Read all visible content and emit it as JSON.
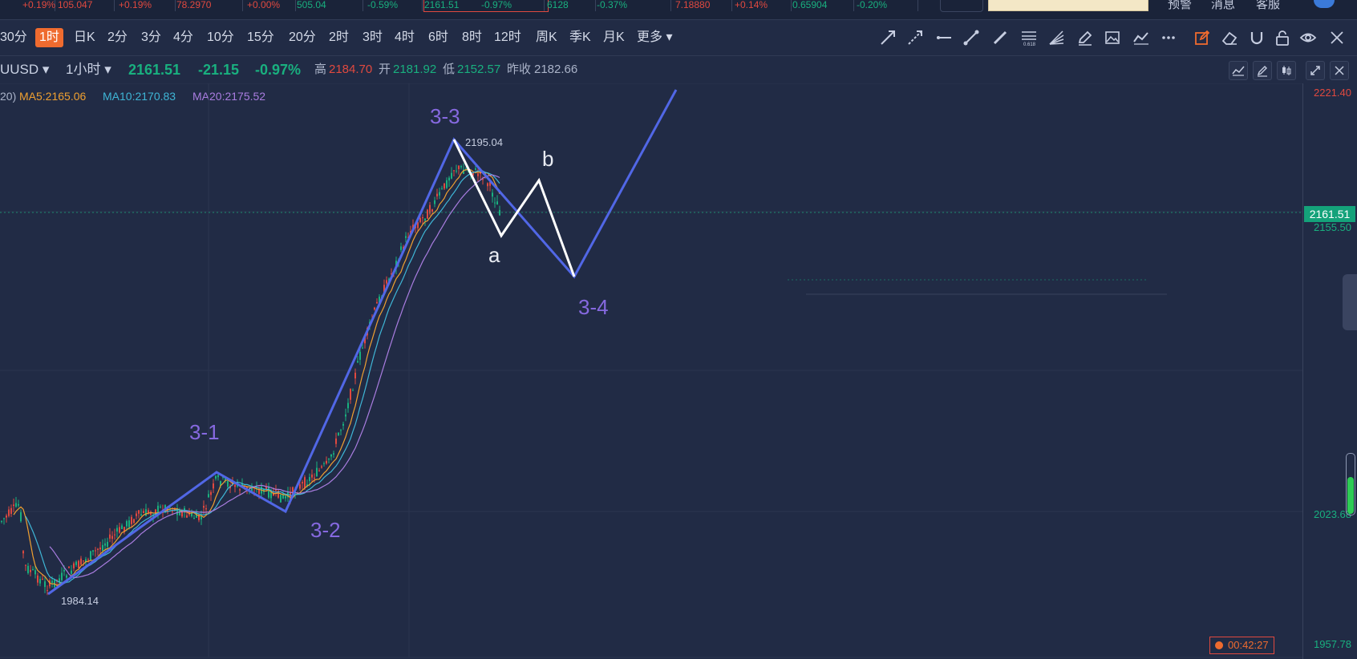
{
  "top_strip": {
    "cells": [
      {
        "text": "+0.19%",
        "color": "red"
      },
      {
        "text": "105.047",
        "color": "red"
      },
      {
        "text": "+0.19%",
        "color": "red"
      },
      {
        "text": "78.2970",
        "color": "red"
      },
      {
        "text": "+0.00%",
        "color": "red"
      },
      {
        "text": "505.04",
        "color": "green"
      },
      {
        "text": "-0.59%",
        "color": "green"
      },
      {
        "text": "2161.51",
        "color": "green",
        "active": true
      },
      {
        "text": "-0.97%",
        "color": "green"
      },
      {
        "text": "6128",
        "color": "green"
      },
      {
        "text": "-0.37%",
        "color": "green"
      },
      {
        "text": "7.18880",
        "color": "red"
      },
      {
        "text": "+0.14%",
        "color": "red"
      },
      {
        "text": "0.65904",
        "color": "green"
      },
      {
        "text": "-0.20%",
        "color": "green"
      }
    ],
    "links": [
      "预警",
      "消息",
      "客服"
    ]
  },
  "timeframes": {
    "items": [
      "30分",
      "1时",
      "日K",
      "2分",
      "3分",
      "4分",
      "10分",
      "15分",
      "20分",
      "2时",
      "3时",
      "4时",
      "6时",
      "8时",
      "12时",
      "周K",
      "季K",
      "月K",
      "更多"
    ],
    "active": "1时"
  },
  "draw_tools": [
    "arrow-line-icon",
    "dashed-arrow-icon",
    "horizontal-ray-icon",
    "trend-line-icon",
    "segment-icon",
    "fibonacci-icon",
    "fan-icon",
    "pencil-icon",
    "image-icon",
    "polyline-icon",
    "more-dots-icon",
    "edit-active-icon",
    "eraser-icon",
    "magnet-icon",
    "lock-icon",
    "eye-icon",
    "close-icon"
  ],
  "quote": {
    "symbol": "UUSD",
    "interval": "1小时",
    "price": "2161.51",
    "change": "-21.15",
    "change_pct": "-0.97%",
    "high_label": "高",
    "high": "2184.70",
    "open_label": "开",
    "open": "2181.92",
    "low_label": "低",
    "low": "2152.57",
    "prev_close_label": "昨收",
    "prev_close": "2182.66"
  },
  "ma_legend": {
    "prefix": "20)",
    "ma5": "MA5:2165.06",
    "ma10": "MA10:2170.83",
    "ma20": "MA20:2175.52"
  },
  "price_axis": {
    "labels": [
      {
        "text": "2221.40",
        "color": "red"
      },
      {
        "text": "2155.50",
        "color": "green"
      },
      {
        "text": "2023.68",
        "color": "green"
      },
      {
        "text": "1957.78",
        "color": "green"
      }
    ],
    "current_tag": "2161.51"
  },
  "annotations": {
    "wave_3_1": "3-1",
    "wave_3_2": "3-2",
    "wave_3_3": "3-3",
    "wave_3_4": "3-4",
    "wave_a": "a",
    "wave_b": "b",
    "peak": "2195.04",
    "trough": "1984.14"
  },
  "countdown": "00:42:27",
  "colors": {
    "background": "#212b45",
    "up": "#e0493f",
    "down": "#19b07f",
    "active_tab": "#ef6b2f",
    "wave_line": "#5167e6",
    "wave_label": "#8669e0",
    "correction_line": "#ffffff"
  }
}
